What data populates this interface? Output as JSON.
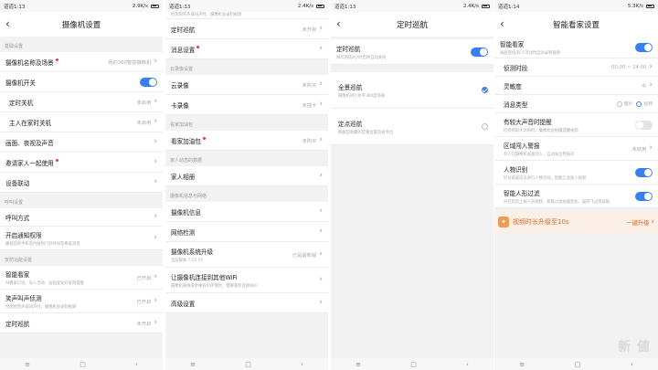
{
  "status": {
    "p1": {
      "carrier": "道道1:13",
      "speed": "2.9K/s"
    },
    "p2": {
      "carrier": "道道1:13",
      "speed": "2.4K/s"
    },
    "p3": {
      "carrier": "道道1:13",
      "speed": "2.4K/s"
    },
    "p4": {
      "carrier": "道道1:14",
      "speed": "5.3K/s"
    }
  },
  "nav": {
    "menu": "≡",
    "home": "□",
    "back": "‹"
  },
  "p1": {
    "title": "摄像机设置",
    "sec_basic": "基础设置",
    "name_label": "摄像机名称及场景",
    "name_value": "我的360智能摄像机",
    "switch_label": "摄像机开关",
    "timed_off_label": "定时关机",
    "timed_off_value": "未启用",
    "home_off_label": "主人在家时关机",
    "home_off_value": "未启用",
    "picture_label": "画面、夜视及声音",
    "invite_label": "邀请家人一起使用",
    "linkage_label": "设备联动",
    "sec_call": "呼叫设置",
    "call_label": "呼叫方式",
    "notify_label": "开启通知权限",
    "notify_sub": "确保您的手机及时收到门铃呼叫及看家消息",
    "sec_security": "安防功能设置",
    "smart_label": "智能看家",
    "smart_sub": "AI看家识别，有人活动、画面变化好家则提醒",
    "smart_value": "已开启",
    "cry_label": "笑声叫声侦测",
    "cry_sub": "检测到笑声或叫声时，摄像机会录制视频",
    "cry_value": "已开启",
    "cruise_label": "定时巡航",
    "cruise_value": "未开启"
  },
  "p2": {
    "top_sub": "检测到笑声或叫声时，摄像机会录制视频",
    "cruise_label": "定时巡航",
    "cruise_value": "未开启",
    "msg_label": "消息设置",
    "sec_cloud": "云录像设置",
    "cloud_label": "云录像",
    "cloud_value": "未购买",
    "card_label": "卡录像",
    "card_value": "未插卡",
    "sec_pack": "看家加油包",
    "pack_label": "看家加油包",
    "pack_value": "未购买",
    "sec_family": "家人动态的数据",
    "album_label": "家人相册",
    "sec_info": "摄像机信息与网络",
    "info_label": "摄像机信息",
    "network_label": "网络检测",
    "upgrade_label": "摄像机系统升级",
    "upgrade_sub": "当前版本 7.12.15",
    "upgrade_value": "已是最新版",
    "wifi_label": "让摄像机连接到其他WiFi",
    "wifi_sub": "摄像机离线或更换WiFi环境时，需要重新连接WiFi",
    "advanced_label": "高级设置"
  },
  "p3": {
    "title": "定时巡航",
    "cruise_label": "定时巡航",
    "cruise_sub": "每次巡航4小时后将自动关闭",
    "full_label": "全景巡航",
    "full_sub": "摄像机进行水平360度巡视",
    "point_label": "定点巡航",
    "point_sub": "根据您收藏的常看位置巡视点位"
  },
  "p4": {
    "title": "智能看家设置",
    "smart_label": "智能看家",
    "smart_sub": "画面变化/有人活动时自动录制视频",
    "period_label": "侦测时段",
    "period_value": "00:00 ~ 24:00",
    "sens_label": "灵敏度",
    "sens_value": "中",
    "type_label": "消息类型",
    "type_opt1": "图片",
    "type_opt2": "视频",
    "loud_label": "有较大声音时提醒",
    "loud_sub": "检测到较大声响时，摄像机会拍摄提醒视频",
    "zone_label": "区域闯入警报",
    "zone_sub": "有人在摄像机画面闯入，自动发出警报声",
    "zone_value": "未启用",
    "human_label": "人物识别",
    "human_sub": "针对家庭成员进行人物识别，智能汇总家人视频",
    "filter_label": "智能人形过滤",
    "filter_sub": "开启后仅上报人形视频，智能过滤画面变化、猫狗飞过等误报",
    "promo_text": "视频时长升级至10s",
    "promo_btn": "一键升级",
    "watermark": "新 値"
  },
  "colors": {
    "accent": "#3a7ff0",
    "promo": "#d86a2a",
    "dot": "#e53935"
  }
}
